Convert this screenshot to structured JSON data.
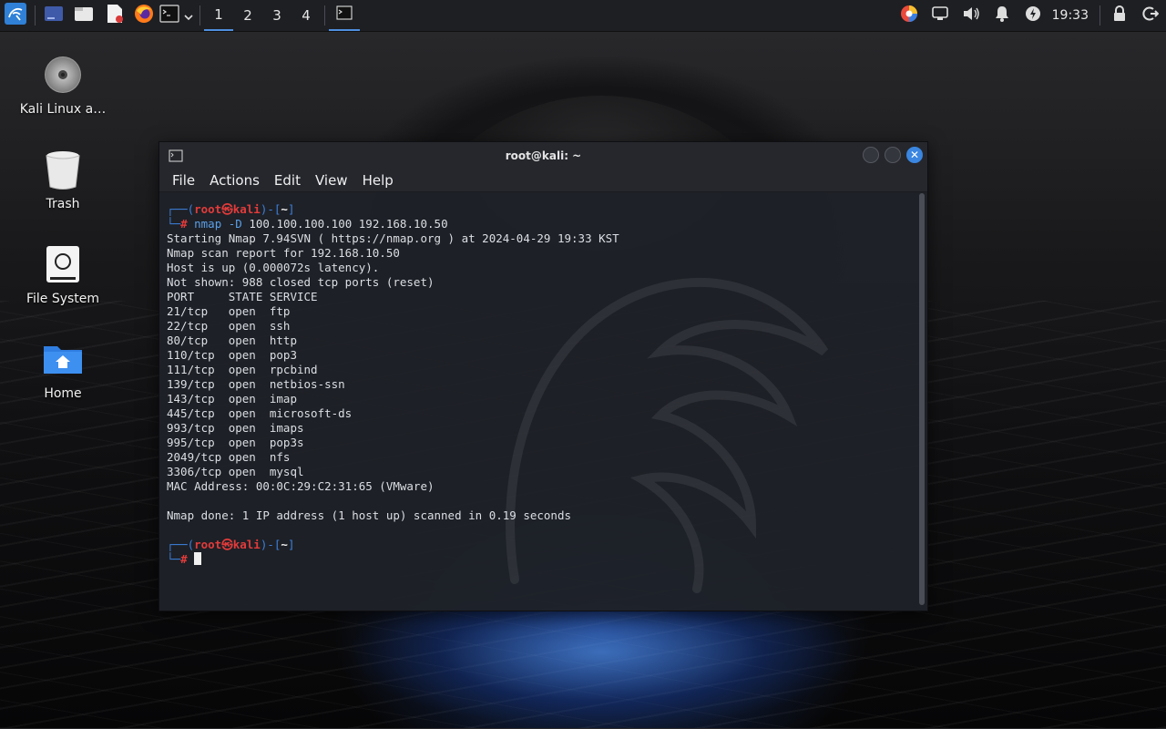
{
  "panel": {
    "workspaces": [
      "1",
      "2",
      "3",
      "4"
    ],
    "active_workspace": "1",
    "clock": "19:33",
    "icons": [
      "kali-menu-icon",
      "show-desktop-icon",
      "file-manager-icon",
      "text-editor-icon",
      "firefox-icon",
      "terminal-icon",
      "chevron-down-icon",
      "terminal-task-icon",
      "color-picker-icon",
      "network-icon",
      "volume-icon",
      "notifications-icon",
      "power-manager-icon",
      "lock-icon",
      "logout-icon"
    ]
  },
  "desktop": {
    "icons": [
      {
        "label": "Kali Linux a…",
        "icon": "disc-icon"
      },
      {
        "label": "Trash",
        "icon": "trash-icon"
      },
      {
        "label": "File System",
        "icon": "drive-icon"
      },
      {
        "label": "Home",
        "icon": "home-folder-icon"
      }
    ]
  },
  "window": {
    "title": "root@kali: ~",
    "menu": [
      "File",
      "Actions",
      "Edit",
      "View",
      "Help"
    ]
  },
  "terminal": {
    "prompt_user": "root",
    "prompt_at": "㉿",
    "prompt_host": "kali",
    "prompt_dir": "~",
    "command": "nmap -D 100.100.100.100 192.168.10.50",
    "cmd_word": "nmap",
    "cmd_flag": "-D",
    "cmd_args": "100.100.100.100 192.168.10.50",
    "output": [
      "Starting Nmap 7.94SVN ( https://nmap.org ) at 2024-04-29 19:33 KST",
      "Nmap scan report for 192.168.10.50",
      "Host is up (0.000072s latency).",
      "Not shown: 988 closed tcp ports (reset)",
      "PORT     STATE SERVICE",
      "21/tcp   open  ftp",
      "22/tcp   open  ssh",
      "80/tcp   open  http",
      "110/tcp  open  pop3",
      "111/tcp  open  rpcbind",
      "139/tcp  open  netbios-ssn",
      "143/tcp  open  imap",
      "445/tcp  open  microsoft-ds",
      "993/tcp  open  imaps",
      "995/tcp  open  pop3s",
      "2049/tcp open  nfs",
      "3306/tcp open  mysql",
      "MAC Address: 00:0C:29:C2:31:65 (VMware)",
      "",
      "Nmap done: 1 IP address (1 host up) scanned in 0.19 seconds"
    ]
  },
  "colors": {
    "accent": "#3a86e0",
    "prompt_red": "#e23b3b",
    "prompt_blue": "#3d7fdb"
  }
}
